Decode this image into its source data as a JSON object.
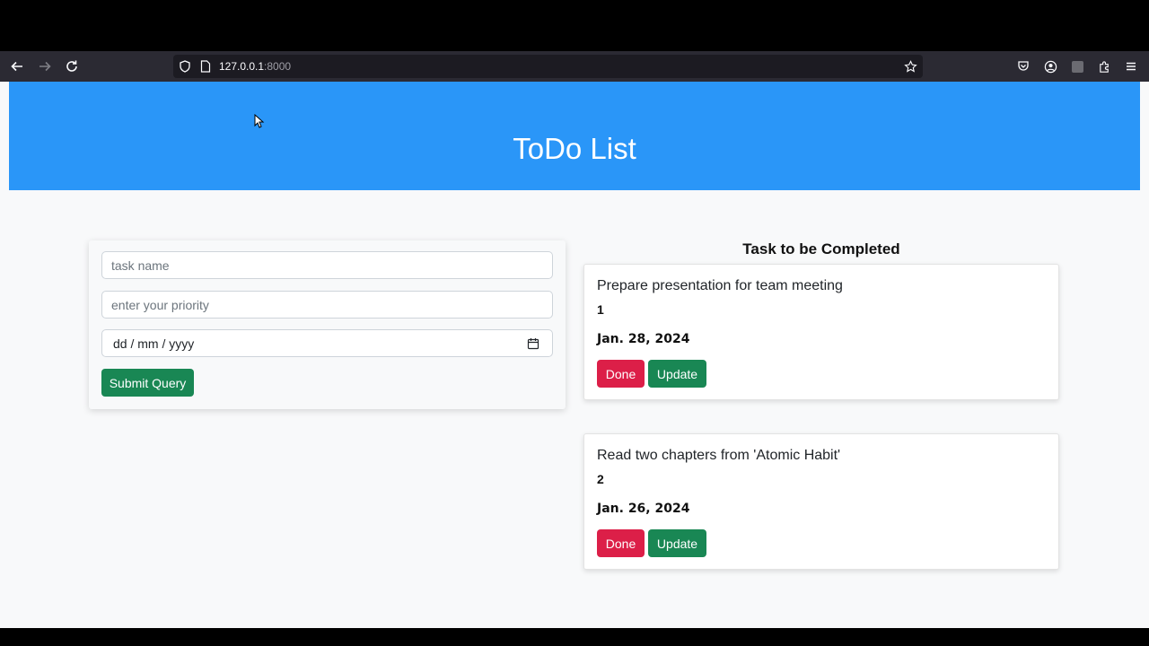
{
  "browser": {
    "url_host": "127.0.0.1",
    "url_port": ":8000"
  },
  "page": {
    "title": "ToDo List"
  },
  "form": {
    "task_placeholder": "task name",
    "priority_placeholder": "enter your priority",
    "date_placeholder": "dd / mm / yyyy",
    "submit_label": "Submit Query"
  },
  "tasks_section": {
    "title": "Task to be Completed"
  },
  "tasks": [
    {
      "name": "Prepare presentation for team meeting",
      "priority": "1",
      "date": "Jan. 28, 2024",
      "done_label": "Done",
      "update_label": "Update"
    },
    {
      "name": "Read two chapters from 'Atomic Habit'",
      "priority": "2",
      "date": "Jan. 26, 2024",
      "done_label": "Done",
      "update_label": "Update"
    }
  ],
  "colors": {
    "banner": "#2a96f8",
    "success": "#198754",
    "danger": "#dc1f48"
  }
}
